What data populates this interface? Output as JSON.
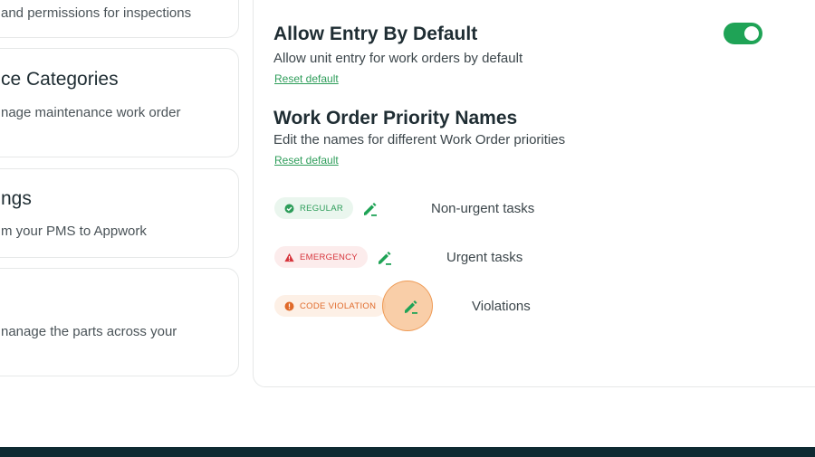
{
  "left_cards": [
    {
      "title": "",
      "description": "and permissions for inspections"
    },
    {
      "title": "ce Categories",
      "description": "nage maintenance work order"
    },
    {
      "title": "ngs",
      "description": "m your PMS to Appwork"
    },
    {
      "title": "",
      "description": "nanage the parts across your"
    }
  ],
  "allow_entry": {
    "title": "Allow Entry By Default",
    "description": "Allow unit entry for work orders by default",
    "reset_label": "Reset default",
    "toggle_on": true
  },
  "priority_names": {
    "title": "Work Order Priority Names",
    "description": "Edit the names for different Work Order priorities",
    "reset_label": "Reset default",
    "items": [
      {
        "badge": "REGULAR",
        "badge_icon": "check-circle-icon",
        "badge_color": "#2e9d5a",
        "badge_bg": "#eaf6ee",
        "description": "Non-urgent tasks"
      },
      {
        "badge": "EMERGENCY",
        "badge_icon": "warning-triangle-icon",
        "badge_color": "#d6343b",
        "badge_bg": "#fcecec",
        "description": "Urgent tasks"
      },
      {
        "badge": "CODE VIOLATION",
        "badge_icon": "info-circle-icon",
        "badge_color": "#e06a2a",
        "badge_bg": "#fdf0e6",
        "description": "Violations"
      }
    ]
  },
  "colors": {
    "accent_green": "#1fa356",
    "footer": "#0e2a32",
    "click_highlight": "#f4a660"
  }
}
